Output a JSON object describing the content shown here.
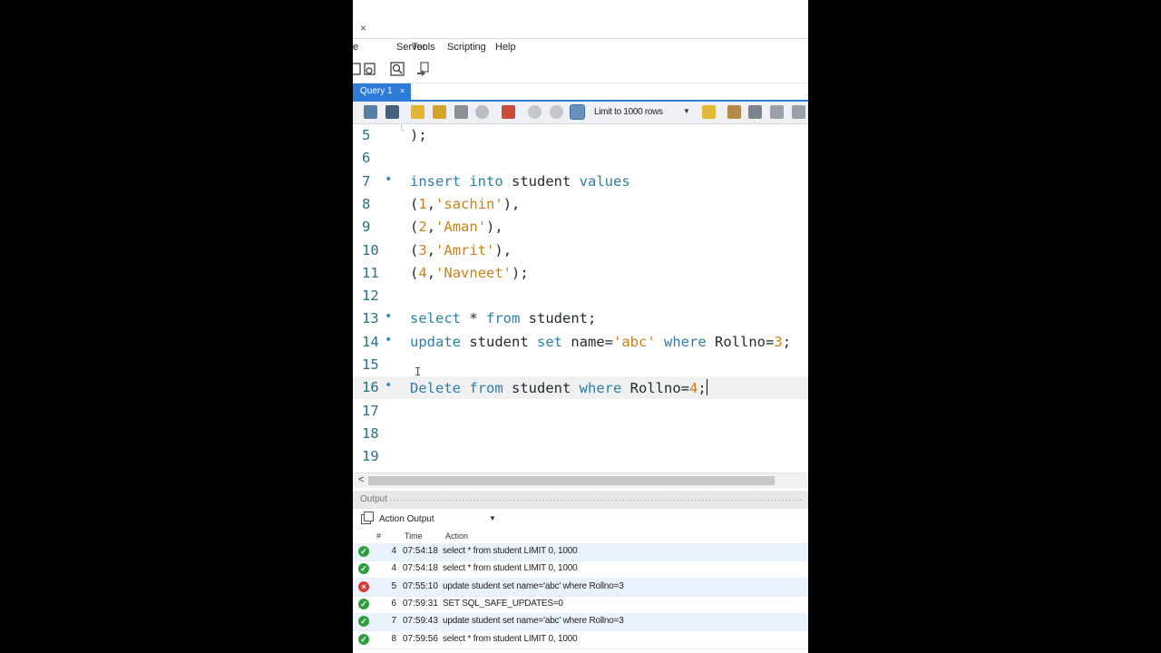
{
  "window": {
    "close_glyph": "×"
  },
  "menu": [
    {
      "label": "e"
    },
    {
      "label": "Server"
    },
    {
      "label": "Tools"
    },
    {
      "label": "Scripting"
    },
    {
      "label": "Help"
    }
  ],
  "tab": {
    "label": "Query 1",
    "close_glyph": "×"
  },
  "query_toolbar": {
    "limit_label": "Limit to 1000 rows",
    "icons": [
      "open-folder-icon",
      "save-icon",
      "execute-icon",
      "execute-current-icon",
      "explain-icon",
      "stop-icon",
      "toggle-results-icon",
      "commit-icon",
      "rollback-icon",
      "autocommit-icon",
      "beautify-icon",
      "clear-icon",
      "find-icon",
      "invisibles-icon",
      "wrap-icon"
    ]
  },
  "editor": {
    "lines": [
      {
        "num": "5",
        "marker": "",
        "tokens": [
          {
            "t": ");",
            "c": ""
          }
        ]
      },
      {
        "num": "6",
        "marker": "",
        "tokens": []
      },
      {
        "num": "7",
        "marker": "•",
        "tokens": [
          {
            "t": "insert",
            "c": "kw"
          },
          {
            "t": " ",
            "c": ""
          },
          {
            "t": "into",
            "c": "kw"
          },
          {
            "t": " student ",
            "c": ""
          },
          {
            "t": "values",
            "c": "kw"
          }
        ]
      },
      {
        "num": "8",
        "marker": "",
        "tokens": [
          {
            "t": "(",
            "c": ""
          },
          {
            "t": "1",
            "c": "num"
          },
          {
            "t": ",",
            "c": ""
          },
          {
            "t": "'sachin'",
            "c": "str"
          },
          {
            "t": "),",
            "c": ""
          }
        ]
      },
      {
        "num": "9",
        "marker": "",
        "tokens": [
          {
            "t": "(",
            "c": ""
          },
          {
            "t": "2",
            "c": "num"
          },
          {
            "t": ",",
            "c": ""
          },
          {
            "t": "'Aman'",
            "c": "str"
          },
          {
            "t": "),",
            "c": ""
          }
        ]
      },
      {
        "num": "10",
        "marker": "",
        "tokens": [
          {
            "t": "(",
            "c": ""
          },
          {
            "t": "3",
            "c": "num"
          },
          {
            "t": ",",
            "c": ""
          },
          {
            "t": "'Amrit'",
            "c": "str"
          },
          {
            "t": "),",
            "c": ""
          }
        ]
      },
      {
        "num": "11",
        "marker": "",
        "tokens": [
          {
            "t": "(",
            "c": ""
          },
          {
            "t": "4",
            "c": "num"
          },
          {
            "t": ",",
            "c": ""
          },
          {
            "t": "'Navneet'",
            "c": "str"
          },
          {
            "t": ");",
            "c": ""
          }
        ]
      },
      {
        "num": "12",
        "marker": "",
        "tokens": []
      },
      {
        "num": "13",
        "marker": "•",
        "tokens": [
          {
            "t": "select",
            "c": "kw"
          },
          {
            "t": " * ",
            "c": ""
          },
          {
            "t": "from",
            "c": "kw"
          },
          {
            "t": " student;",
            "c": ""
          }
        ]
      },
      {
        "num": "14",
        "marker": "•",
        "tokens": [
          {
            "t": "update",
            "c": "kw"
          },
          {
            "t": " student ",
            "c": ""
          },
          {
            "t": "set",
            "c": "kw"
          },
          {
            "t": " name=",
            "c": ""
          },
          {
            "t": "'abc'",
            "c": "str"
          },
          {
            "t": " ",
            "c": ""
          },
          {
            "t": "where",
            "c": "kw"
          },
          {
            "t": " Rollno=",
            "c": ""
          },
          {
            "t": "3",
            "c": "num"
          },
          {
            "t": ";",
            "c": ""
          }
        ]
      },
      {
        "num": "15",
        "marker": "",
        "tokens": []
      },
      {
        "num": "16",
        "marker": "•",
        "current": true,
        "tokens": [
          {
            "t": "Delete",
            "c": "kw"
          },
          {
            "t": " ",
            "c": ""
          },
          {
            "t": "from",
            "c": "kw"
          },
          {
            "t": " student ",
            "c": ""
          },
          {
            "t": "where",
            "c": "kw"
          },
          {
            "t": " Rollno=",
            "c": ""
          },
          {
            "t": "4",
            "c": "num"
          },
          {
            "t": ";",
            "c": ""
          }
        ]
      },
      {
        "num": "17",
        "marker": "",
        "tokens": []
      },
      {
        "num": "18",
        "marker": "",
        "tokens": []
      },
      {
        "num": "19",
        "marker": "",
        "tokens": []
      }
    ]
  },
  "output": {
    "panel_title": "Output",
    "selector_value": "Action Output",
    "columns": {
      "num": "#",
      "time": "Time",
      "action": "Action"
    },
    "rows": [
      {
        "status": "ok",
        "num": "4",
        "time": "07:54:18",
        "action": "select * from student LIMIT 0, 1000"
      },
      {
        "status": "ok",
        "num": "4",
        "time": "07:54:18",
        "action": "select * from student LIMIT 0, 1000"
      },
      {
        "status": "err",
        "num": "5",
        "time": "07:55:10",
        "action": "update student set name='abc' where Rollno=3"
      },
      {
        "status": "ok",
        "num": "6",
        "time": "07:59:31",
        "action": "SET SQL_SAFE_UPDATES=0"
      },
      {
        "status": "ok",
        "num": "7",
        "time": "07:59:43",
        "action": "update student set name='abc' where Rollno=3"
      },
      {
        "status": "ok",
        "num": "8",
        "time": "07:59:56",
        "action": "select * from student LIMIT 0, 1000"
      }
    ],
    "status_glyphs": {
      "ok": "✓",
      "err": "×"
    }
  },
  "colors": {
    "keyword": "#2c7fa8",
    "string": "#c9821b",
    "line_number": "#2b6f86",
    "tab_accent": "#2f7bd8",
    "ok": "#2e9f3e",
    "error": "#d63b3b"
  }
}
